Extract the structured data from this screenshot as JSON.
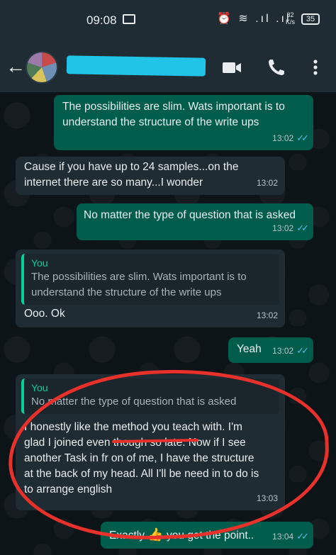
{
  "status_bar": {
    "time": "09:08",
    "speed_top": "32",
    "speed_bottom": "K/s",
    "battery": "35"
  },
  "header": {
    "contact_name": "[redacted]"
  },
  "messages": [
    {
      "direction": "out",
      "text": "The possibilities are slim. Wats important is to understand the structure of the write ups",
      "time": "13:02",
      "ticks": "✓✓"
    },
    {
      "direction": "in",
      "text": "Cause if you have up to 24 samples...on the internet there are so many...I wonder",
      "time": "13:02"
    },
    {
      "direction": "out",
      "text": "No matter the type of question that is asked",
      "time": "13:02",
      "ticks": "✓✓"
    },
    {
      "direction": "in",
      "quote_author": "You",
      "quote_text": "The possibilities are slim. Wats important is to understand the structure of the write ups",
      "text": "Ooo. Ok",
      "time": "13:02"
    },
    {
      "direction": "out",
      "text": "Yeah",
      "time": "13:02",
      "ticks": "✓✓"
    },
    {
      "direction": "in",
      "quote_author": "You",
      "quote_text": "No matter the type of question that is asked",
      "text": "I honestly like the method you teach with. I'm glad I joined even though so late. Now if I see another Task in fr on of me, I have the structure at the back of my head. All I'll be need in to do is to arrange english",
      "time": "13:03"
    },
    {
      "direction": "out",
      "text_before": "Exactly",
      "text_after": "you get the point..",
      "time": "13:04",
      "ticks": "✓✓"
    }
  ],
  "colors": {
    "outgoing_bubble": "#005c4b",
    "incoming_bubble": "#1f2c34",
    "quote_accent": "#06cf9c",
    "read_ticks": "#53bdeb",
    "annotation": "#e8312a"
  }
}
